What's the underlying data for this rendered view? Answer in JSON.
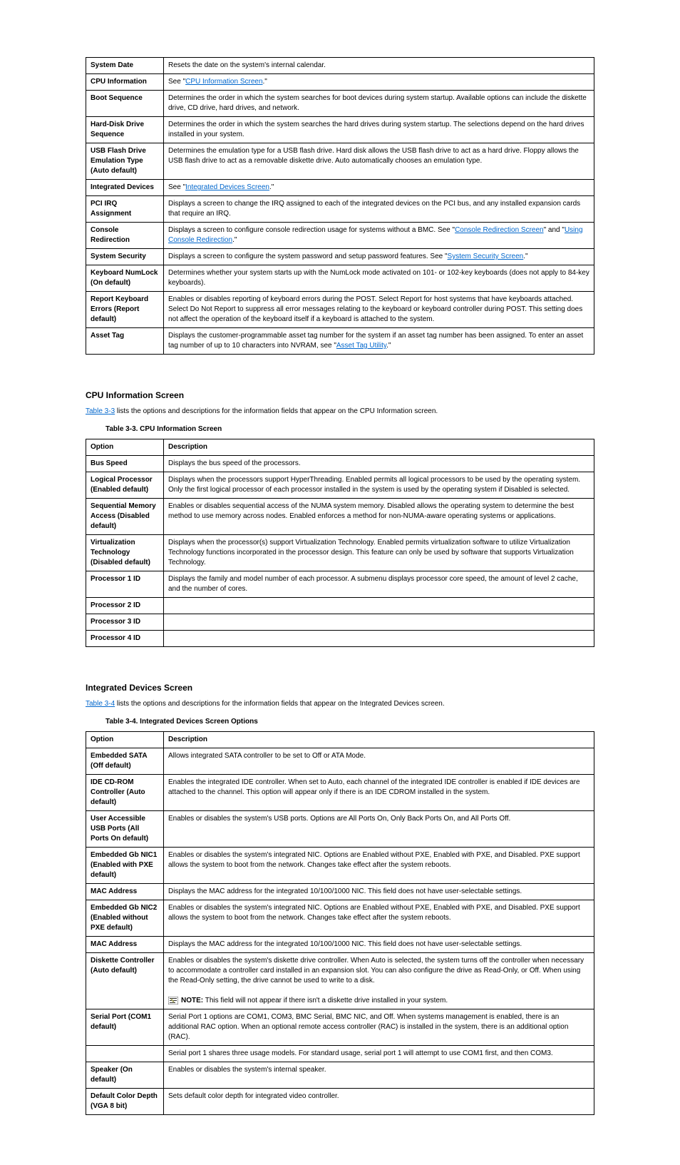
{
  "links": {
    "cpu_info_screen": "CPU Information Screen",
    "integrated_devices_screen": "Integrated Devices Screen",
    "system_security_screen": "System Security Screen",
    "asset_tag_utility": "Asset Tag Utility",
    "table3_a": "Table 3",
    "hyphen_a": "-",
    "num3": "3",
    "table3_b": "Table 3",
    "hyphen_b": "-",
    "num4": "4"
  },
  "t1": {
    "r1": {
      "opt": "System Date",
      "desc": "Resets the date on the system's internal calendar."
    },
    "r2": {
      "opt": "CPU Information",
      "desc_pre": "See \"",
      "desc_post": ".\""
    },
    "r3": {
      "opt": "Boot Sequence",
      "desc": "Determines the order in which the system searches for boot devices during system startup. Available options can include the diskette drive, CD drive, hard drives, and network."
    },
    "r4": {
      "opt": "Hard-Disk Drive Sequence",
      "desc": "Determines the order in which the system searches the hard drives during system startup. The selections depend on the hard drives installed in your system."
    },
    "r5": {
      "opt": "USB Flash Drive Emulation Type (Auto default)",
      "desc": "Determines the emulation type for a USB flash drive. Hard disk allows the USB flash drive to act as a hard drive. Floppy allows the USB flash drive to act as a removable diskette drive. Auto automatically chooses an emulation type."
    },
    "r6": {
      "opt": "Integrated Devices",
      "desc_pre": "See \"",
      "desc_post": ".\""
    },
    "r7": {
      "opt": "PCI IRQ Assignment",
      "desc": "Displays a screen to change the IRQ assigned to each of the integrated devices on the PCI bus, and any installed expansion cards that require an IRQ."
    },
    "r8": {
      "opt": "Console Redirection",
      "desc_pre": "Displays a screen to configure console redirection usage for systems without a BMC. See \"",
      "desc_link": "Console Redirection Screen",
      "desc_mid": "\" and \"",
      "desc_link2": "Using Console Redirection",
      "desc_post": ".\""
    },
    "r9": {
      "opt": "System Security",
      "desc_pre": "Displays a screen to configure the system password and setup password features. See \"",
      "desc_post": ".\""
    },
    "r10": {
      "opt": "Keyboard NumLock (On default)",
      "desc": "Determines whether your system starts up with the NumLock mode activated on 101- or 102-key keyboards (does not apply to 84-key keyboards)."
    },
    "r11": {
      "opt": "Report Keyboard Errors (Report default)",
      "desc": "Enables or disables reporting of keyboard errors during the POST. Select Report for host systems that have keyboards attached. Select Do Not Report to suppress all error messages relating to the keyboard or keyboard controller during POST. This setting does not affect the operation of the keyboard itself if a keyboard is attached to the system."
    },
    "r12": {
      "opt": "Asset Tag",
      "desc_line1": "Displays the customer-programmable asset tag number for the system if an asset tag number has been assigned. To enter an asset",
      "desc_line2_pre": "tag number of up to 10 characters into NVRAM, see \"",
      "desc_line2_post": ".\""
    }
  },
  "cpu": {
    "intro_pre": "",
    "intro_link": "",
    "intro_post": " lists the options and descriptions for the information fields that appear on the CPU Information screen.",
    "caption_prefix": "Table 3",
    "caption_sep": "-",
    "caption": "3. CPU Information Screen",
    "head": {
      "c1": "Option",
      "c2": "Description"
    },
    "r1": {
      "opt": "Bus Speed",
      "desc": "Displays the bus speed of the processors."
    },
    "r2": {
      "opt": "Logical Processor (Enabled default)",
      "desc": "Displays when the processors support HyperThreading. Enabled permits all logical processors to be used by the operating system. Only the first logical processor of each processor installed in the system is used by the operating system if Disabled is selected."
    },
    "r3": {
      "opt": "Sequential Memory Access (Disabled default)",
      "desc": "Enables or disables sequential access of the NUMA system memory. Disabled allows the operating system to determine the best method to use memory across nodes. Enabled enforces a method for non-NUMA-aware operating systems or applications."
    },
    "r4": {
      "opt": "Virtualization Technology (Disabled default)",
      "desc": "Displays when the processor(s) support Virtualization Technology. Enabled permits virtualization software to utilize Virtualization Technology functions incorporated in the processor design. This feature can only be used by software that supports Virtualization Technology."
    },
    "r5": {
      "opt": "Processor 1 ID",
      "desc": "Displays the family and model number of each processor. A submenu displays processor core speed, the amount of level 2 cache, and the number of cores."
    },
    "r6": {
      "opt": "Processor 2 ID",
      "desc": ""
    },
    "r7": {
      "opt": "Processor 3 ID",
      "desc": ""
    },
    "r8": {
      "opt": "Processor 4 ID",
      "desc": ""
    }
  },
  "intdev": {
    "intro_post": " lists the options and descriptions for the information fields that appear on the Integrated Devices screen.",
    "caption": "4. Integrated Devices Screen Options",
    "head": {
      "c1": "Option",
      "c2": "Description"
    },
    "r1": {
      "opt": "Embedded SATA (Off default)",
      "desc": "Allows integrated SATA controller to be set to Off or ATA Mode."
    },
    "r2": {
      "opt": "IDE CD-ROM Controller (Auto default)",
      "desc": "Enables the integrated IDE controller. When set to Auto, each channel of the integrated IDE controller is enabled if IDE devices are attached to the channel. This option will appear only if there is an IDE CDROM installed in the system."
    },
    "r3": {
      "opt": "User Accessible USB Ports (All Ports On default)",
      "desc": "Enables or disables the system's USB ports. Options are All Ports On, Only Back Ports On, and All Ports Off."
    },
    "r4": {
      "opt": "Embedded Gb NIC1 (Enabled with PXE default)",
      "desc": "Enables or disables the system's integrated NIC. Options are Enabled without PXE, Enabled with PXE, and Disabled. PXE support allows the system to boot from the network. Changes take effect after the system reboots."
    },
    "r5": {
      "opt": "MAC Address",
      "desc": "Displays the MAC address for the integrated 10/100/1000 NIC. This field does not have user-selectable settings."
    },
    "r6": {
      "opt": "Embedded Gb NIC2 (Enabled without PXE default)",
      "desc": "Enables or disables the system's integrated NIC. Options are Enabled without PXE, Enabled with PXE, and Disabled. PXE support allows the system to boot from the network. Changes take effect after the system reboots."
    },
    "r7": {
      "opt": "MAC Address",
      "desc": "Displays the MAC address for the integrated 10/100/1000 NIC. This field does not have user-selectable settings."
    },
    "r8": {
      "opt": "Diskette Controller (Auto default)",
      "desc_line1": "Enables or disables the system's diskette drive controller. When Auto is selected, the system turns off the controller when necessary to accommodate a controller card installed in an expansion slot. You can also configure the drive as Read-Only, or Off. When using the Read-Only setting, the drive cannot be used to write to a disk.",
      "note_label": "NOTE:",
      "note_text": " This field will not appear if there isn't a diskette drive installed in your system."
    },
    "r9": {
      "opt": "Serial Port (COM1 default)",
      "desc": "Serial Port 1 options are COM1, COM3, BMC Serial, BMC NIC, and Off. When systems management is enabled, there is an additional RAC option. When an optional remote access controller (RAC) is installed in the system, there is an additional option (RAC)."
    },
    "r10": {
      "opt": "",
      "desc": "Serial port 1 shares three usage models. For standard usage, serial port 1 will attempt to use COM1 first, and then COM3."
    },
    "r11": {
      "opt": "Speaker (On default)",
      "desc": "Enables or disables the system's internal speaker."
    },
    "r12": {
      "opt": "Default Color Depth (VGA 8 bit)",
      "desc": "Sets default color depth for integrated video controller."
    }
  },
  "headings": {
    "cpu": "CPU Information Screen",
    "intdev": "Integrated Devices Screen"
  }
}
